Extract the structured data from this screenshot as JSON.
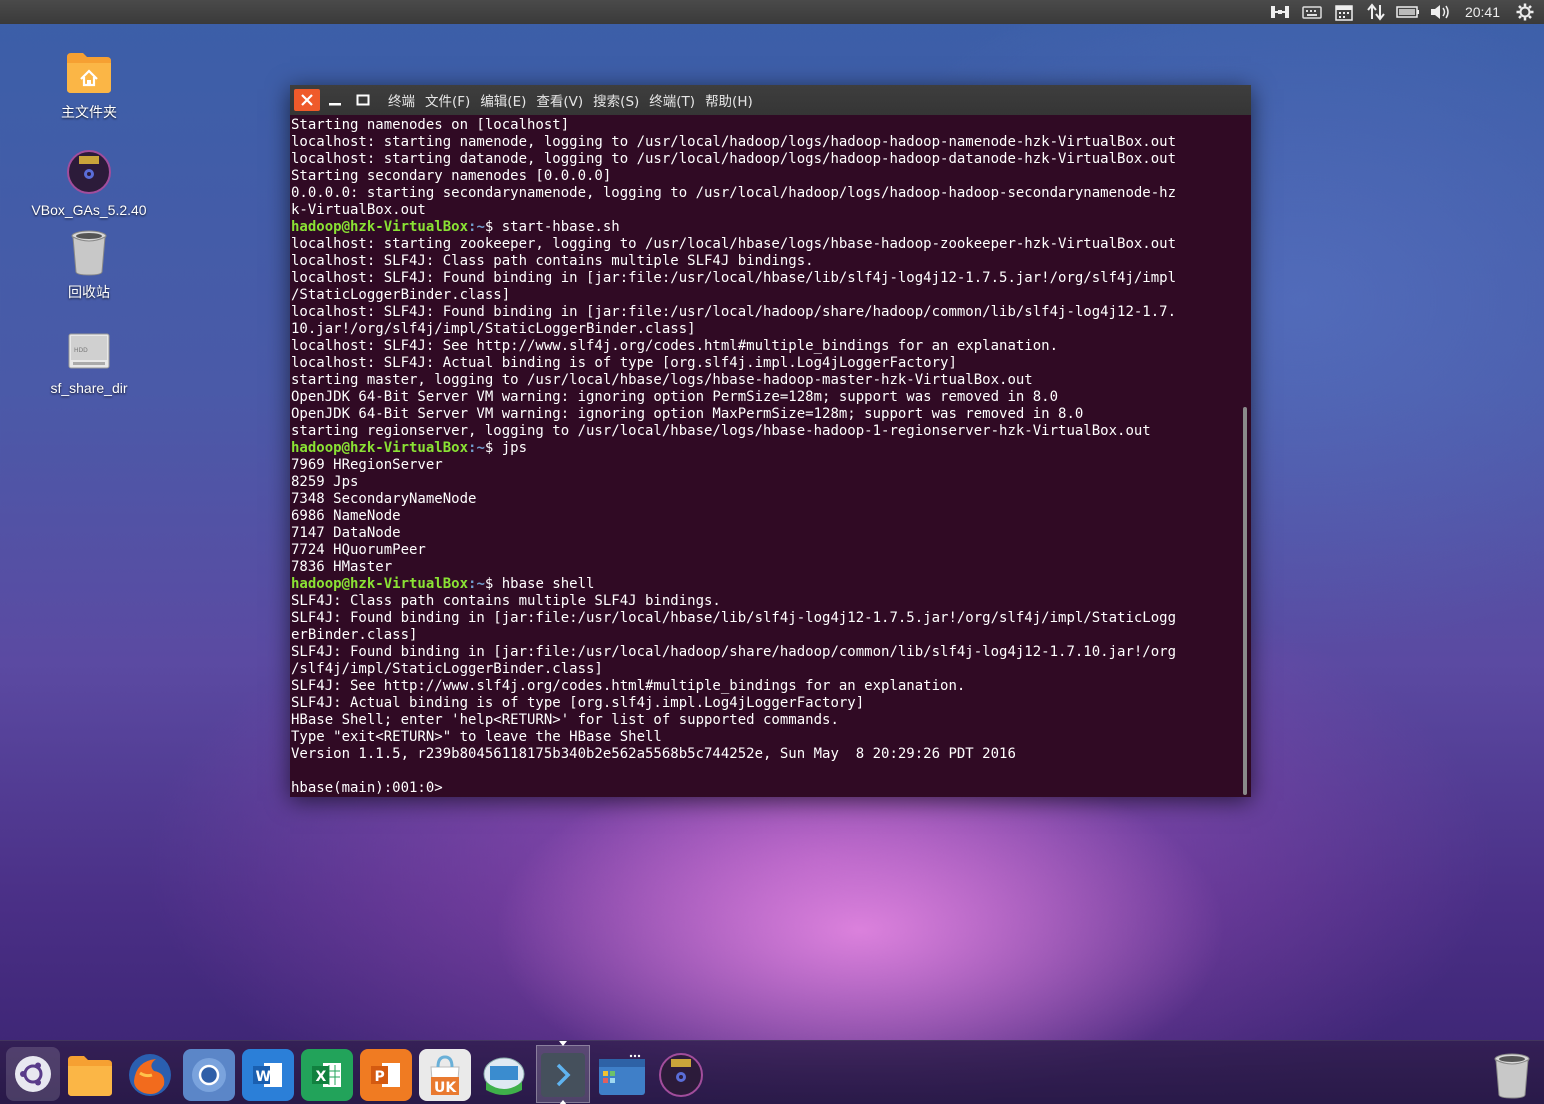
{
  "top_panel": {
    "clock": "20:41",
    "icons": [
      "network-icon",
      "keyboard-icon",
      "calendar-icon",
      "transfer-icon",
      "battery-icon",
      "volume-icon",
      "power-gear-icon"
    ]
  },
  "desktop": {
    "items": [
      {
        "label": "主文件夹",
        "icon": "home-folder-icon"
      },
      {
        "label": "VBox_GAs_5.2.40",
        "icon": "disc-icon"
      },
      {
        "label": "回收站",
        "icon": "trash-icon"
      },
      {
        "label": "sf_share_dir",
        "icon": "drive-icon"
      }
    ]
  },
  "terminal": {
    "menu": [
      "终端",
      "文件(F)",
      "编辑(E)",
      "查看(V)",
      "搜索(S)",
      "终端(T)",
      "帮助(H)"
    ],
    "prompt_user": "hadoop@hzk-VirtualBox",
    "prompt_path": ":~",
    "lines": [
      {
        "text": "Starting namenodes on [localhost]"
      },
      {
        "text": "localhost: starting namenode, logging to /usr/local/hadoop/logs/hadoop-hadoop-namenode-hzk-VirtualBox.out"
      },
      {
        "text": "localhost: starting datanode, logging to /usr/local/hadoop/logs/hadoop-hadoop-datanode-hzk-VirtualBox.out"
      },
      {
        "text": "Starting secondary namenodes [0.0.0.0]"
      },
      {
        "text": "0.0.0.0: starting secondarynamenode, logging to /usr/local/hadoop/logs/hadoop-hadoop-secondarynamenode-hz"
      },
      {
        "text": "k-VirtualBox.out"
      },
      {
        "prompt": true,
        "cmd": "$ start-hbase.sh"
      },
      {
        "text": "localhost: starting zookeeper, logging to /usr/local/hbase/logs/hbase-hadoop-zookeeper-hzk-VirtualBox.out"
      },
      {
        "text": "localhost: SLF4J: Class path contains multiple SLF4J bindings."
      },
      {
        "text": "localhost: SLF4J: Found binding in [jar:file:/usr/local/hbase/lib/slf4j-log4j12-1.7.5.jar!/org/slf4j/impl"
      },
      {
        "text": "/StaticLoggerBinder.class]"
      },
      {
        "text": "localhost: SLF4J: Found binding in [jar:file:/usr/local/hadoop/share/hadoop/common/lib/slf4j-log4j12-1.7."
      },
      {
        "text": "10.jar!/org/slf4j/impl/StaticLoggerBinder.class]"
      },
      {
        "text": "localhost: SLF4J: See http://www.slf4j.org/codes.html#multiple_bindings for an explanation."
      },
      {
        "text": "localhost: SLF4J: Actual binding is of type [org.slf4j.impl.Log4jLoggerFactory]"
      },
      {
        "text": "starting master, logging to /usr/local/hbase/logs/hbase-hadoop-master-hzk-VirtualBox.out"
      },
      {
        "text": "OpenJDK 64-Bit Server VM warning: ignoring option PermSize=128m; support was removed in 8.0"
      },
      {
        "text": "OpenJDK 64-Bit Server VM warning: ignoring option MaxPermSize=128m; support was removed in 8.0"
      },
      {
        "text": "starting regionserver, logging to /usr/local/hbase/logs/hbase-hadoop-1-regionserver-hzk-VirtualBox.out"
      },
      {
        "prompt": true,
        "cmd": "$ jps"
      },
      {
        "text": "7969 HRegionServer"
      },
      {
        "text": "8259 Jps"
      },
      {
        "text": "7348 SecondaryNameNode"
      },
      {
        "text": "6986 NameNode"
      },
      {
        "text": "7147 DataNode"
      },
      {
        "text": "7724 HQuorumPeer"
      },
      {
        "text": "7836 HMaster"
      },
      {
        "prompt": true,
        "cmd": "$ hbase shell"
      },
      {
        "text": "SLF4J: Class path contains multiple SLF4J bindings."
      },
      {
        "text": "SLF4J: Found binding in [jar:file:/usr/local/hbase/lib/slf4j-log4j12-1.7.5.jar!/org/slf4j/impl/StaticLogg"
      },
      {
        "text": "erBinder.class]"
      },
      {
        "text": "SLF4J: Found binding in [jar:file:/usr/local/hadoop/share/hadoop/common/lib/slf4j-log4j12-1.7.10.jar!/org"
      },
      {
        "text": "/slf4j/impl/StaticLoggerBinder.class]"
      },
      {
        "text": "SLF4J: See http://www.slf4j.org/codes.html#multiple_bindings for an explanation."
      },
      {
        "text": "SLF4J: Actual binding is of type [org.slf4j.impl.Log4jLoggerFactory]"
      },
      {
        "text": "HBase Shell; enter 'help<RETURN>' for list of supported commands."
      },
      {
        "text": "Type \"exit<RETURN>\" to leave the HBase Shell"
      },
      {
        "text": "Version 1.1.5, r239b80456118175b340b2e562a5568b5c744252e, Sun May  8 20:29:26 PDT 2016"
      },
      {
        "text": ""
      },
      {
        "text": "hbase(main):001:0> "
      }
    ]
  },
  "dock": {
    "items": [
      {
        "name": "ubuntu-logo-icon"
      },
      {
        "name": "files-icon"
      },
      {
        "name": "firefox-icon"
      },
      {
        "name": "chromium-icon"
      },
      {
        "name": "wps-writer-icon",
        "letter": "W"
      },
      {
        "name": "wps-spreadsheet-icon",
        "letter": "X"
      },
      {
        "name": "wps-presentation-icon",
        "letter": "P"
      },
      {
        "name": "ubuntu-kylin-software-icon",
        "letter": "UK"
      },
      {
        "name": "remote-desktop-icon"
      },
      {
        "name": "terminal-icon",
        "active": true
      },
      {
        "name": "workspace-switcher-icon"
      },
      {
        "name": "disc-drive-icon"
      },
      {
        "name": "trash-icon"
      }
    ]
  },
  "colors": {
    "terminal_bg": "#300a24",
    "prompt_user": "#8ae234",
    "prompt_path": "#729fcf",
    "close_button": "#ef5a2a"
  }
}
